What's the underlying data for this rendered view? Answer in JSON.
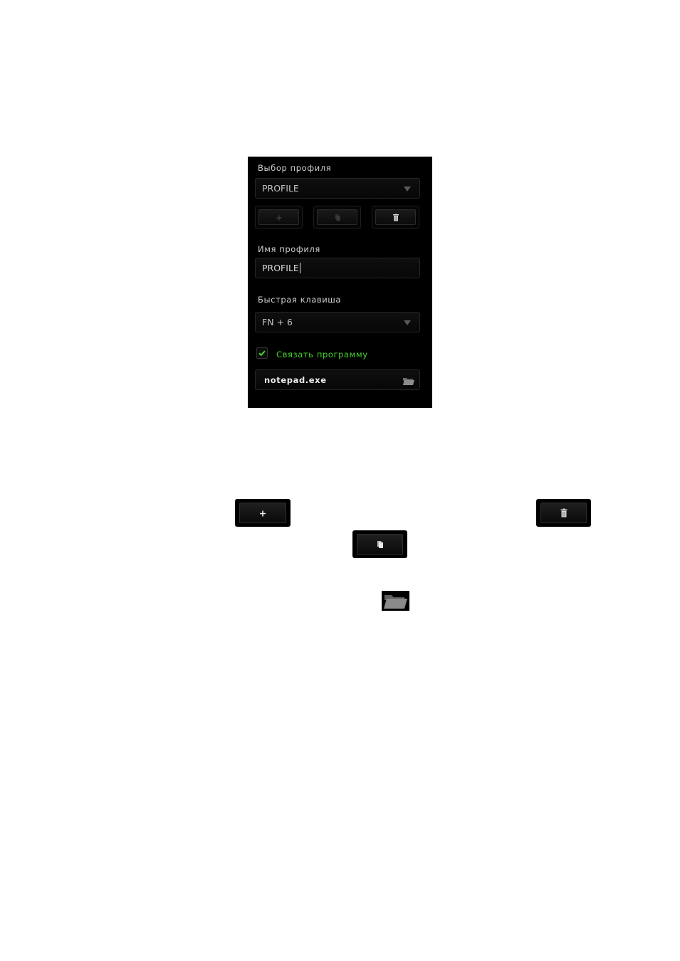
{
  "panel": {
    "profile_select_label": "Выбор профиля",
    "profile_selected": "PROFILE",
    "profile_name_label": "Имя профиля",
    "profile_name_value": "PROFILE",
    "hotkey_label": "Быстрая клавиша",
    "hotkey_value": "FN + 6",
    "link_program_label": "Связать программу",
    "link_program_checked": true,
    "program_path": "notepad.exe"
  },
  "buttons": {
    "add_icon": "plus-icon",
    "copy_icon": "copy-icon",
    "delete_icon": "trash-icon",
    "browse_icon": "folder-icon"
  },
  "colors": {
    "accent_green": "#44d62c",
    "panel_bg": "#000000"
  }
}
